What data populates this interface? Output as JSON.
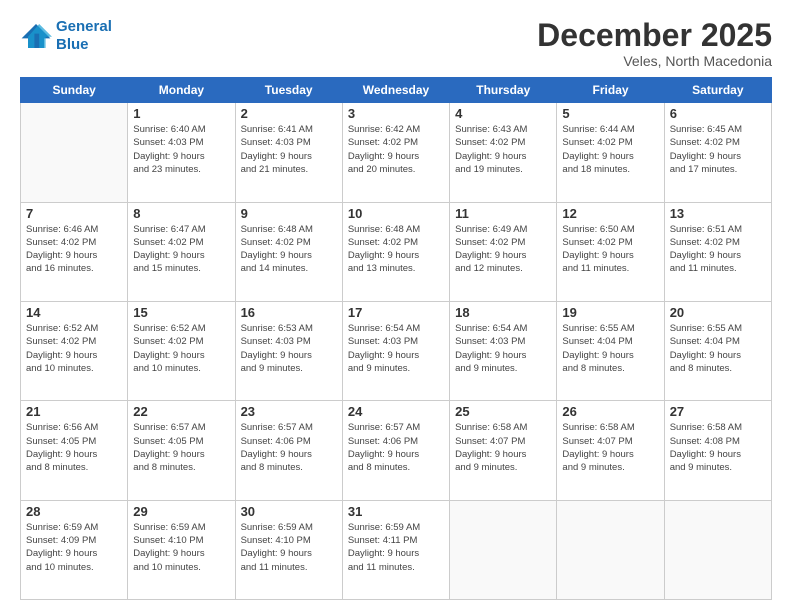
{
  "logo": {
    "line1": "General",
    "line2": "Blue"
  },
  "header": {
    "title": "December 2025",
    "subtitle": "Veles, North Macedonia"
  },
  "days_of_week": [
    "Sunday",
    "Monday",
    "Tuesday",
    "Wednesday",
    "Thursday",
    "Friday",
    "Saturday"
  ],
  "weeks": [
    [
      {
        "day": "",
        "info": ""
      },
      {
        "day": "1",
        "info": "Sunrise: 6:40 AM\nSunset: 4:03 PM\nDaylight: 9 hours\nand 23 minutes."
      },
      {
        "day": "2",
        "info": "Sunrise: 6:41 AM\nSunset: 4:03 PM\nDaylight: 9 hours\nand 21 minutes."
      },
      {
        "day": "3",
        "info": "Sunrise: 6:42 AM\nSunset: 4:02 PM\nDaylight: 9 hours\nand 20 minutes."
      },
      {
        "day": "4",
        "info": "Sunrise: 6:43 AM\nSunset: 4:02 PM\nDaylight: 9 hours\nand 19 minutes."
      },
      {
        "day": "5",
        "info": "Sunrise: 6:44 AM\nSunset: 4:02 PM\nDaylight: 9 hours\nand 18 minutes."
      },
      {
        "day": "6",
        "info": "Sunrise: 6:45 AM\nSunset: 4:02 PM\nDaylight: 9 hours\nand 17 minutes."
      }
    ],
    [
      {
        "day": "7",
        "info": "Sunrise: 6:46 AM\nSunset: 4:02 PM\nDaylight: 9 hours\nand 16 minutes."
      },
      {
        "day": "8",
        "info": "Sunrise: 6:47 AM\nSunset: 4:02 PM\nDaylight: 9 hours\nand 15 minutes."
      },
      {
        "day": "9",
        "info": "Sunrise: 6:48 AM\nSunset: 4:02 PM\nDaylight: 9 hours\nand 14 minutes."
      },
      {
        "day": "10",
        "info": "Sunrise: 6:48 AM\nSunset: 4:02 PM\nDaylight: 9 hours\nand 13 minutes."
      },
      {
        "day": "11",
        "info": "Sunrise: 6:49 AM\nSunset: 4:02 PM\nDaylight: 9 hours\nand 12 minutes."
      },
      {
        "day": "12",
        "info": "Sunrise: 6:50 AM\nSunset: 4:02 PM\nDaylight: 9 hours\nand 11 minutes."
      },
      {
        "day": "13",
        "info": "Sunrise: 6:51 AM\nSunset: 4:02 PM\nDaylight: 9 hours\nand 11 minutes."
      }
    ],
    [
      {
        "day": "14",
        "info": "Sunrise: 6:52 AM\nSunset: 4:02 PM\nDaylight: 9 hours\nand 10 minutes."
      },
      {
        "day": "15",
        "info": "Sunrise: 6:52 AM\nSunset: 4:02 PM\nDaylight: 9 hours\nand 10 minutes."
      },
      {
        "day": "16",
        "info": "Sunrise: 6:53 AM\nSunset: 4:03 PM\nDaylight: 9 hours\nand 9 minutes."
      },
      {
        "day": "17",
        "info": "Sunrise: 6:54 AM\nSunset: 4:03 PM\nDaylight: 9 hours\nand 9 minutes."
      },
      {
        "day": "18",
        "info": "Sunrise: 6:54 AM\nSunset: 4:03 PM\nDaylight: 9 hours\nand 9 minutes."
      },
      {
        "day": "19",
        "info": "Sunrise: 6:55 AM\nSunset: 4:04 PM\nDaylight: 9 hours\nand 8 minutes."
      },
      {
        "day": "20",
        "info": "Sunrise: 6:55 AM\nSunset: 4:04 PM\nDaylight: 9 hours\nand 8 minutes."
      }
    ],
    [
      {
        "day": "21",
        "info": "Sunrise: 6:56 AM\nSunset: 4:05 PM\nDaylight: 9 hours\nand 8 minutes."
      },
      {
        "day": "22",
        "info": "Sunrise: 6:57 AM\nSunset: 4:05 PM\nDaylight: 9 hours\nand 8 minutes."
      },
      {
        "day": "23",
        "info": "Sunrise: 6:57 AM\nSunset: 4:06 PM\nDaylight: 9 hours\nand 8 minutes."
      },
      {
        "day": "24",
        "info": "Sunrise: 6:57 AM\nSunset: 4:06 PM\nDaylight: 9 hours\nand 8 minutes."
      },
      {
        "day": "25",
        "info": "Sunrise: 6:58 AM\nSunset: 4:07 PM\nDaylight: 9 hours\nand 9 minutes."
      },
      {
        "day": "26",
        "info": "Sunrise: 6:58 AM\nSunset: 4:07 PM\nDaylight: 9 hours\nand 9 minutes."
      },
      {
        "day": "27",
        "info": "Sunrise: 6:58 AM\nSunset: 4:08 PM\nDaylight: 9 hours\nand 9 minutes."
      }
    ],
    [
      {
        "day": "28",
        "info": "Sunrise: 6:59 AM\nSunset: 4:09 PM\nDaylight: 9 hours\nand 10 minutes."
      },
      {
        "day": "29",
        "info": "Sunrise: 6:59 AM\nSunset: 4:10 PM\nDaylight: 9 hours\nand 10 minutes."
      },
      {
        "day": "30",
        "info": "Sunrise: 6:59 AM\nSunset: 4:10 PM\nDaylight: 9 hours\nand 11 minutes."
      },
      {
        "day": "31",
        "info": "Sunrise: 6:59 AM\nSunset: 4:11 PM\nDaylight: 9 hours\nand 11 minutes."
      },
      {
        "day": "",
        "info": ""
      },
      {
        "day": "",
        "info": ""
      },
      {
        "day": "",
        "info": ""
      }
    ]
  ]
}
